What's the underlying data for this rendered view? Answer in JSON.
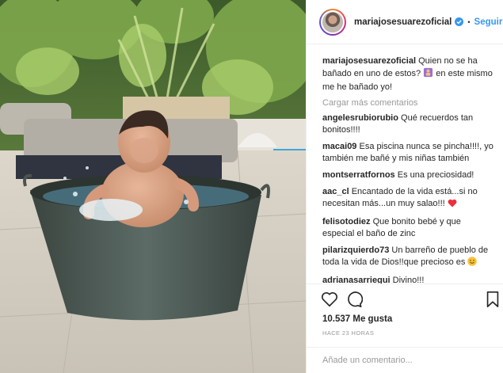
{
  "photo": {
    "alt_icon": "baby-bath-photo"
  },
  "header": {
    "username": "mariajosesuarezoficial",
    "separator": "•",
    "follow_label": "Seguir",
    "verified_icon": "verified-badge-icon"
  },
  "caption": {
    "user": "mariajosesuarezoficial",
    "text": "Quien no se ha bañado en uno de estos?",
    "emoji": "raised-hand-emoji",
    "text_after": "en este mismo me he bañado yo!"
  },
  "load_more": "Cargar más comentarios",
  "comments": [
    {
      "user": "angelesrubiorubio",
      "text": "Qué recuerdos tan bonitos!!!!"
    },
    {
      "user": "macai09",
      "text": "Esa piscina nunca se pincha!!!!, yo también me bañé y mis niñas también"
    },
    {
      "user": "montserratfornos",
      "text": "Es una preciosidad!"
    },
    {
      "user": "aac_cl",
      "text": "Encantado de la vida está...si no necesitan más...un muy salao!!!",
      "emoji": "heart-emoji"
    },
    {
      "user": "felisotodiez",
      "text": "Que bonito bebé y que especial el baño de zinc"
    },
    {
      "user": "pilarizquierdo73",
      "text": "Un barreño de pueblo de toda la vida de Dios!!que precioso es",
      "emoji": "smile-emoji"
    },
    {
      "user": "adrianasarriegui",
      "text": "Divino!!!"
    }
  ],
  "actions": {
    "like_icon": "heart-icon",
    "comment_icon": "comment-icon",
    "save_icon": "bookmark-icon"
  },
  "likes": "10.537 Me gusta",
  "timestamp": "HACE 23 HORAS",
  "add_comment": {
    "placeholder": "Añade un comentario..."
  },
  "colors": {
    "link": "#3897f0",
    "text": "#262626",
    "muted": "#999999",
    "heart": "#ed4956"
  }
}
